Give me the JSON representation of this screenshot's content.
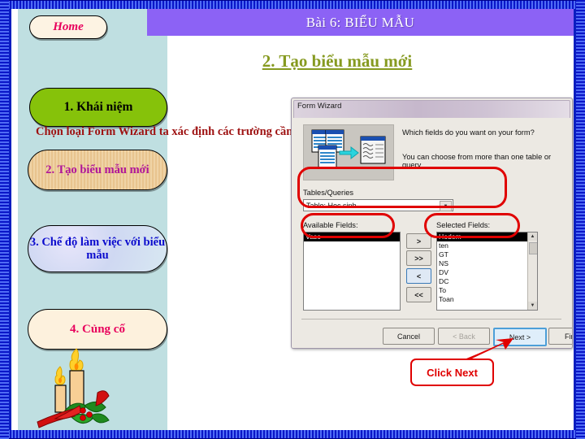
{
  "slide": {
    "title_bar": "Bài 6: BIỂU MẪU",
    "heading": "2. Tạo biểu mẫu mới",
    "body_text": "Chọn loại Form Wizard ta xác định các trường cần đưa vào biểu mẫu"
  },
  "sidebar": {
    "home_label": "Home",
    "items": [
      {
        "label": "1. Khái niệm"
      },
      {
        "label": "2. Tạo biểu mẫu mới"
      },
      {
        "label": "3. Chế độ làm việc với biểu mẫu"
      },
      {
        "label": "4. Củng cố"
      }
    ],
    "decoration": "christmas-candles-holly"
  },
  "wizard": {
    "title": "Form Wizard",
    "question_1": "Which fields do you want on your form?",
    "question_2": "You can choose from more than one table or query.",
    "tables_queries_label": "Tables/Queries",
    "tables_queries_value": "Table: Hoc sinh",
    "available_fields_label": "Available Fields:",
    "selected_fields_label": "Selected Fields:",
    "available_fields": [
      "Vaso"
    ],
    "selected_fields": [
      "Hodem",
      "ten",
      "GT",
      "NS",
      "DV",
      "DC",
      "To",
      "Toan"
    ],
    "selected_index": 0,
    "move_buttons": [
      ">",
      ">>",
      "<",
      "<<"
    ],
    "buttons": {
      "cancel": "Cancel",
      "back": "< Back",
      "next": "Next >",
      "finish": "Finish"
    },
    "combo_arrow": "▼"
  },
  "annotation": {
    "callout_text": "Click Next",
    "callout_color": "#e00000"
  },
  "colors": {
    "title_bar": "#8c62f5",
    "heading": "#869a20",
    "body_text": "#9e1212",
    "sidebar_bg": "#bfdfe1",
    "frame_blue": "#0a1fd8",
    "annotation_red": "#e00000"
  }
}
